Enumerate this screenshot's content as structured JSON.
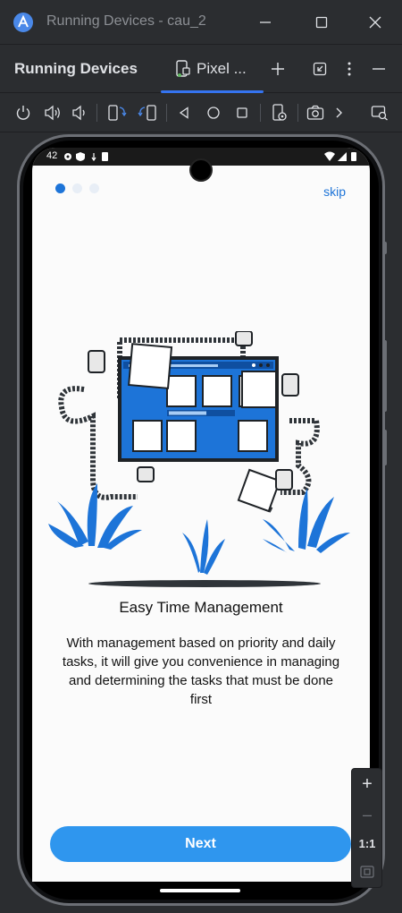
{
  "window": {
    "title": "Running Devices - cau_2",
    "app_icon": "android-studio-logo",
    "buttons": [
      "minimize-icon",
      "maximize-icon",
      "close-icon"
    ]
  },
  "tool_window": {
    "title": "Running Devices",
    "tab_label": "Pixel ...",
    "tab_icon": "device-icon",
    "actions": [
      "add-icon",
      "restore-icon",
      "more-vert-icon",
      "hide-icon"
    ]
  },
  "toolbar": {
    "icons": [
      "power-icon",
      "volume-up-icon",
      "volume-down-icon",
      "rotate-left-icon",
      "rotate-right-icon",
      "back-icon",
      "home-icon",
      "overview-icon",
      "device-settings-icon",
      "screenshot-icon",
      "chevron-right-icon",
      "device-manager-icon"
    ]
  },
  "device": {
    "status_time": "42",
    "onboarding": {
      "page_count": 3,
      "active_page": 1,
      "skip_label": "skip",
      "title": "Easy Time Management",
      "description": "With management based on priority and daily tasks, it will give you convenience in managing and determining the tasks that must be done first",
      "next_label": "Next"
    }
  },
  "zoom_panel": {
    "zoom_in": "+",
    "zoom_out": "–",
    "actual_size": "1:1",
    "fit_icon": "fit-screen-icon"
  },
  "colors": {
    "ide_bg": "#2b2d30",
    "accent": "#3574f0",
    "brand_blue": "#1d74d8",
    "button_blue": "#2f96ee",
    "screen_bg": "#fbfbfb"
  }
}
